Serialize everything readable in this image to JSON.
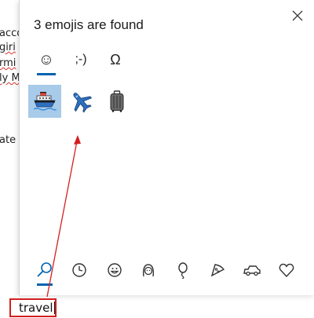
{
  "document": {
    "lines": [
      "acco",
      "giri",
      "rmi",
      "ly M",
      "ate"
    ]
  },
  "panel": {
    "title": "3 emojis are found",
    "tabs": [
      {
        "name": "emoji",
        "label": "☺"
      },
      {
        "name": "kaomoji",
        "label": ";-)"
      },
      {
        "name": "symbols",
        "label": "Ω"
      }
    ],
    "emojis": [
      "ship",
      "airplane",
      "luggage"
    ],
    "categories": [
      "search",
      "recent",
      "smiley",
      "people",
      "celebration",
      "food",
      "transport",
      "heart"
    ]
  },
  "search": {
    "value": "travel"
  },
  "colors": {
    "accent": "#0063b1",
    "selected": "#a7cbe9",
    "highlight": "#d41f1f"
  }
}
